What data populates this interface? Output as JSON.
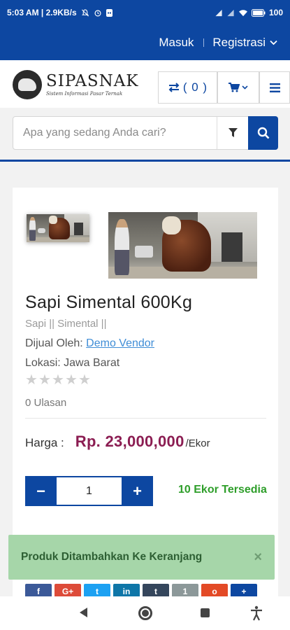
{
  "status_bar": {
    "time_speed": "5:03 AM | 2.9KB/s",
    "battery": "100"
  },
  "top_nav": {
    "login": "Masuk",
    "register": "Registrasi"
  },
  "header": {
    "brand": "SIPASNAK",
    "tagline": "Sistem Informasi Pasar Ternak",
    "compare_count": "( 0 )"
  },
  "search": {
    "placeholder": "Apa yang sedang Anda cari?"
  },
  "product": {
    "title": "Sapi Simental 600Kg",
    "category": "Sapi || Simental ||",
    "seller_label": "Dijual Oleh:",
    "seller_name": "Demo Vendor",
    "location": "Lokasi: Jawa Barat",
    "rating": 0,
    "rating_max": 5,
    "reviews": "0 Ulasan",
    "price_label": "Harga :",
    "price": "Rp. 23,000,000",
    "unit": "/Ekor",
    "qty_minus": "−",
    "qty_value": "1",
    "qty_plus": "+",
    "stock": "10 Ekor Tersedia"
  },
  "share_buttons": [
    {
      "icon": "facebook-icon",
      "glyph": "f",
      "color": "#3b5998"
    },
    {
      "icon": "google-plus-icon",
      "glyph": "G+",
      "color": "#dd4b39"
    },
    {
      "icon": "twitter-icon",
      "glyph": "t",
      "color": "#1da1f2"
    },
    {
      "icon": "linkedin-icon",
      "glyph": "in",
      "color": "#0e76a8"
    },
    {
      "icon": "tumblr-icon",
      "glyph": "t",
      "color": "#35465c"
    },
    {
      "icon": "stumbleupon-icon",
      "glyph": "1",
      "color": "#8c9899"
    },
    {
      "icon": "reddit-icon",
      "glyph": "o",
      "color": "#e34a26"
    },
    {
      "icon": "more-share-icon",
      "glyph": "+",
      "color": "#0d47a1"
    }
  ],
  "toast": {
    "message": "Produk Ditambahkan Ke Keranjang",
    "close": "×"
  },
  "colors": {
    "brand_blue": "#0d47a1",
    "price": "#8b1d52",
    "stock_green": "#2e9e2a",
    "toast_bg": "#a6d6a9"
  }
}
